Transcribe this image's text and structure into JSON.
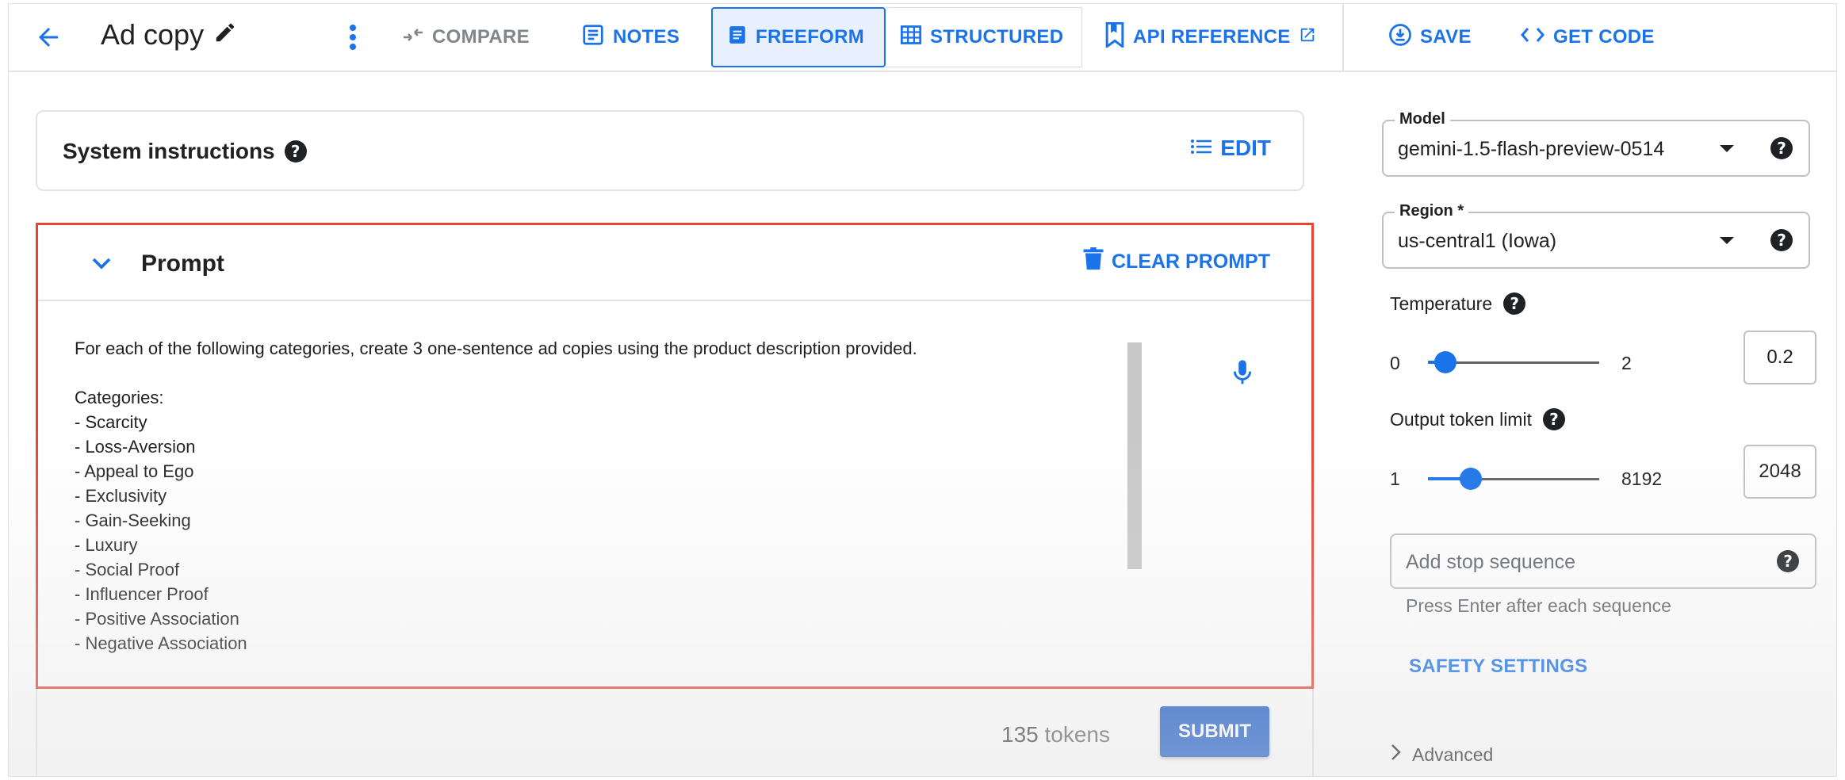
{
  "header": {
    "title": "Ad copy",
    "buttons": {
      "compare": "COMPARE",
      "notes": "NOTES",
      "freeform": "FREEFORM",
      "structured": "STRUCTURED",
      "api_reference": "API REFERENCE",
      "save": "SAVE",
      "get_code": "GET CODE"
    }
  },
  "system_instructions": {
    "title": "System instructions",
    "edit_label": "EDIT"
  },
  "prompt": {
    "title": "Prompt",
    "clear_label": "CLEAR PROMPT",
    "text": "For each of the following categories, create 3 one-sentence ad copies using the product description provided.\n\nCategories:\n- Scarcity\n- Loss-Aversion\n- Appeal to Ego\n- Exclusivity\n- Gain-Seeking\n- Luxury\n- Social Proof\n- Influencer Proof\n- Positive Association\n- Negative Association",
    "token_count": "135",
    "token_unit": "tokens",
    "submit_label": "SUBMIT"
  },
  "settings": {
    "model": {
      "label": "Model",
      "value": "gemini-1.5-flash-preview-0514"
    },
    "region": {
      "label": "Region *",
      "value": "us-central1 (Iowa)"
    },
    "temperature": {
      "label": "Temperature",
      "min": "0",
      "max": "2",
      "value": "0.2",
      "fraction": 0.1
    },
    "output_token_limit": {
      "label": "Output token limit",
      "min": "1",
      "max": "8192",
      "value": "2048",
      "fraction": 0.25
    },
    "stop_sequence": {
      "placeholder": "Add stop sequence",
      "hint": "Press Enter after each sequence"
    },
    "safety_settings_label": "SAFETY SETTINGS",
    "advanced_label": "Advanced"
  },
  "colors": {
    "accent": "#1a73e8",
    "highlight_border": "#ea4335",
    "submit_bg": "#1a5cc8"
  }
}
